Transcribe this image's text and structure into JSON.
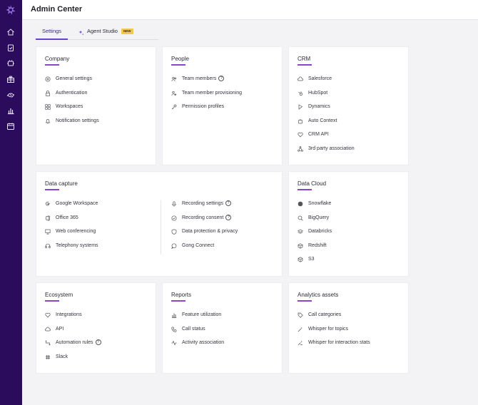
{
  "app": {
    "title": "Admin Center"
  },
  "tabs": [
    {
      "label": "Settings",
      "active": true
    },
    {
      "label": "Agent Studio",
      "badge": "NEW"
    }
  ],
  "sidebar": {
    "icons": [
      "logo-icon",
      "home-icon",
      "clipboard-icon",
      "plugin-icon",
      "gift-icon",
      "hands-icon",
      "bar-chart-icon",
      "calendar-icon"
    ]
  },
  "cards": {
    "company": {
      "title": "Company",
      "items": [
        "General settings",
        "Authentication",
        "Workspaces",
        "Notification settings"
      ]
    },
    "people": {
      "title": "People",
      "items": [
        "Team members",
        "Team member provisioning",
        "Permission profiles"
      ]
    },
    "crm": {
      "title": "CRM",
      "items": [
        "Salesforce",
        "HubSpot",
        "Dynamics",
        "Auto Context",
        "CRM API",
        "3rd party association"
      ]
    },
    "data_capture": {
      "title": "Data capture",
      "left_items": [
        "Google Workspace",
        "Office 365",
        "Web conferencing",
        "Telephony systems"
      ],
      "right_items": [
        "Recording settings",
        "Recording consent",
        "Data protection & privacy",
        "Gong Connect"
      ]
    },
    "data_cloud": {
      "title": "Data Cloud",
      "items": [
        "Snowflake",
        "BigQuery",
        "Databricks",
        "Redshift",
        "S3"
      ]
    },
    "ecosystem": {
      "title": "Ecosystem",
      "items": [
        "Integrations",
        "API",
        "Automation rules",
        "Slack"
      ]
    },
    "reports": {
      "title": "Reports",
      "items": [
        "Feature utilization",
        "Call status",
        "Activity association"
      ]
    },
    "analytics": {
      "title": "Analytics assets",
      "items": [
        "Call categories",
        "Whisper for topics",
        "Whisper for interaction stats"
      ]
    }
  },
  "help_glyph": "?",
  "colors": {
    "sidebar": "#2a0b5c",
    "accent": "#8e44c9",
    "tab_active": "#6a3fd0",
    "badge": "#f2c94c"
  }
}
